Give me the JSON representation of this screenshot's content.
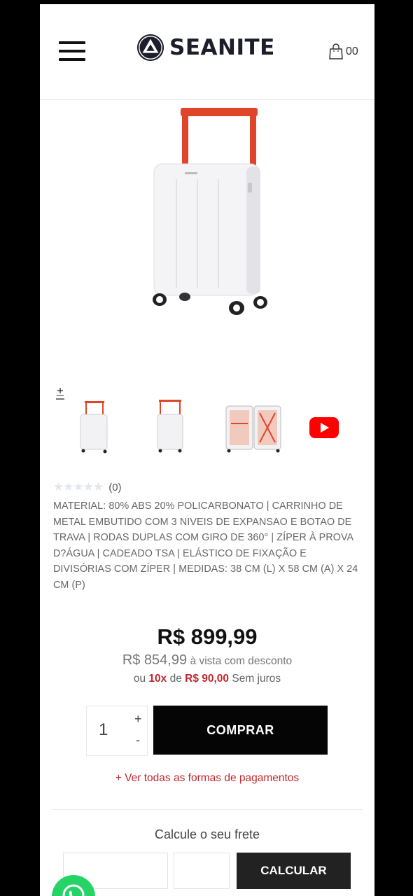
{
  "header": {
    "brand": "SEANITE",
    "cart_count": "00"
  },
  "product": {
    "rating_count": "(0)",
    "description": "MATERIAL: 80% ABS 20% POLICARBONATO | CARRINHO DE METAL EMBUTIDO COM 3 NIVEIS DE EXPANSAO E BOTAO DE TRAVA | RODAS DUPLAS COM GIRO DE 360° | ZÍPER À PROVA D?ÁGUA | CADEADO TSA | ELÁSTICO DE FIXAÇÃO E DIVISÓRIAS COM ZÍPER | MEDIDAS: 38 CM (L) X 58 CM (A) X 24 CM (P)"
  },
  "price": {
    "main": "R$ 899,99",
    "cash_value": "R$ 854,99",
    "cash_text": "à vista com desconto",
    "inst_prefix": "ou",
    "inst_count": "10x",
    "inst_of": "de",
    "inst_value": "R$ 90,00",
    "inst_suffix": "Sem juros"
  },
  "purchase": {
    "quantity": "1",
    "plus": "+",
    "minus": "-",
    "buy_label": "COMPRAR",
    "payment_link": "+ Ver todas as formas de pagamentos"
  },
  "shipping": {
    "title": "Calcule o seu frete",
    "button": "CALCULAR"
  },
  "colors": {
    "accent_red": "#c0272d",
    "handle_orange": "#e0452a",
    "button_black": "#050505"
  },
  "icons": [
    "menu-icon",
    "shopping-bag-icon",
    "zoom-icon",
    "play-icon",
    "whatsapp-icon",
    "star-icon"
  ]
}
